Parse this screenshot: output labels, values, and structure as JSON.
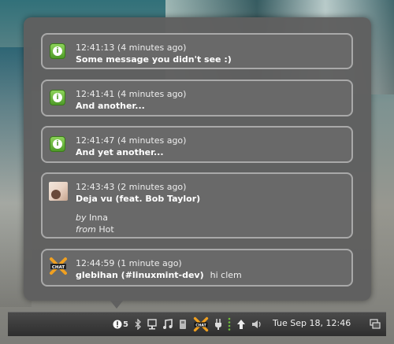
{
  "notifications": [
    {
      "time": "12:41:13 (4 minutes ago)",
      "title": "Some message you didn't see :)",
      "icon": "info-icon"
    },
    {
      "time": "12:41:41 (4 minutes ago)",
      "title": "And another...",
      "icon": "info-icon"
    },
    {
      "time": "12:41:47 (4 minutes ago)",
      "title": "And yet another...",
      "icon": "info-icon"
    },
    {
      "time": "12:43:43 (2 minutes ago)",
      "title": "Deja vu (feat. Bob Taylor)",
      "by_label": "by",
      "artist": "Inna",
      "from_label": "from",
      "album": "Hot",
      "icon": "album-art-icon"
    },
    {
      "time": "12:44:59 (1 minute ago)",
      "title": "glebihan (#linuxmint-dev)",
      "message": "hi clem",
      "icon": "chat-icon"
    }
  ],
  "panel": {
    "notification_count": "5",
    "clock": "Tue Sep 18, 12:46",
    "chat_icon_text": "CHAT",
    "tray_icons": [
      "notifications-icon",
      "bluetooth-icon",
      "network-icon",
      "music-icon",
      "removable-drive-icon",
      "chat-icon",
      "power-icon",
      "update-icon",
      "volume-icon",
      "show-desktop-icon"
    ]
  },
  "colors": {
    "info_green": "#5aa832",
    "popup_bg": "#5f5f5f",
    "border": "#a9a9a9"
  }
}
